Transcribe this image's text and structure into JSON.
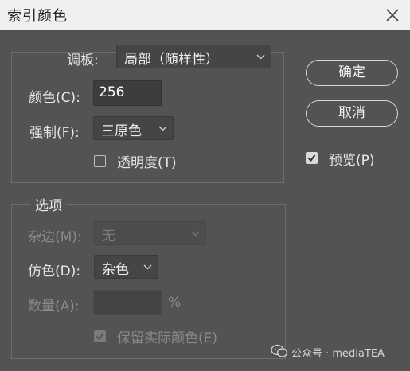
{
  "window": {
    "title": "索引颜色"
  },
  "palette_group": {
    "palette_label": "调板:",
    "palette_value": "局部（随样性）",
    "colors_label": "颜色(C):",
    "colors_value": "256",
    "forced_label": "强制(F):",
    "forced_value": "三原色",
    "transparency_label": "透明度(T)",
    "transparency_checked": false
  },
  "options_group": {
    "title": "选项",
    "matte_label": "杂边(M):",
    "matte_value": "无",
    "matte_enabled": false,
    "dither_label": "仿色(D):",
    "dither_value": "杂色",
    "amount_label": "数量(A):",
    "amount_value": "",
    "amount_unit": "%",
    "amount_enabled": false,
    "preserve_label": "保留实际颜色(E)",
    "preserve_checked": true,
    "preserve_enabled": false
  },
  "buttons": {
    "ok": "确定",
    "cancel": "取消"
  },
  "preview": {
    "label": "预览(P)",
    "checked": true
  },
  "watermark": {
    "text": "公众号 · mediaTEA"
  },
  "colors": {
    "background": "#535353",
    "titlebar": "#f0f0f0",
    "text": "#e6e6e6",
    "disabled_text": "#8a8a8a"
  }
}
